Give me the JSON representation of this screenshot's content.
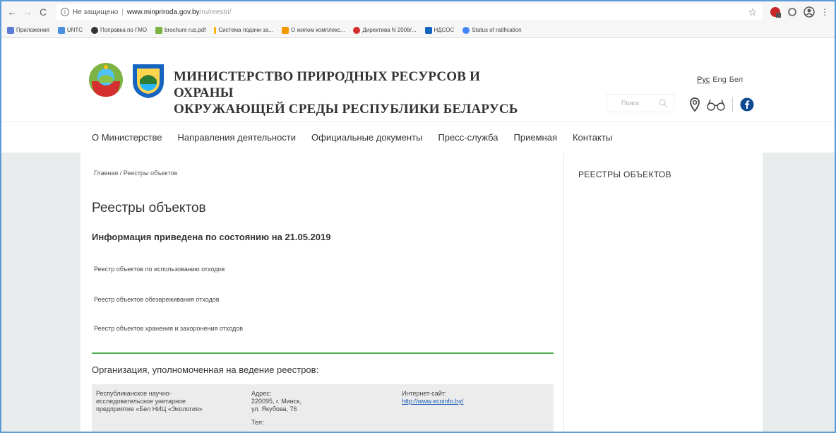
{
  "browser": {
    "security_label": "Не защищено",
    "url_host": "www.minpriroda.gov.by",
    "url_path": "/ru/reestri/"
  },
  "bookmarks": [
    {
      "label": "Приложения",
      "color": "#5b7dd8"
    },
    {
      "label": "UNTC",
      "color": "#4a90e2"
    },
    {
      "label": "Поправка по ГМО",
      "color": "#333333"
    },
    {
      "label": "brochure rus.pdf",
      "color": "#7cb342"
    },
    {
      "label": "Система подачи за...",
      "color": "#f4b400"
    },
    {
      "label": "О жилом комплекс...",
      "color": "#f29900"
    },
    {
      "label": "Директива N 2008/...",
      "color": "#d32f2f"
    },
    {
      "label": "НДСОС",
      "color": "#1565c0"
    },
    {
      "label": "Status of ratification",
      "color": "#4285f4"
    }
  ],
  "header": {
    "title_line1": "МИНИСТЕРСТВО ПРИРОДНЫХ РЕСУРСОВ И ОХРАНЫ",
    "title_line2": "ОКРУЖАЮЩЕЙ СРЕДЫ РЕСПУБЛИКИ БЕЛАРУСЬ",
    "lang_ru": "Рус",
    "lang_en": "Eng",
    "lang_be": "Бел",
    "search_placeholder": "Поиск"
  },
  "menu": [
    "О Министерстве",
    "Направления деятельности",
    "Официальные документы",
    "Пресс-служба",
    "Приемная",
    "Контакты"
  ],
  "main": {
    "breadcrumb": "Главная / Реестры объектов",
    "title": "Реестры объектов",
    "subtitle": "Информация приведена по состоянию на 21.05.2019",
    "links": [
      "Реестр объектов по использованию отходов",
      "Реестр объектов обезвреживания отходов",
      "Реестр объектов хранения и захоронения отходов"
    ],
    "org_title": "Организация, уполномоченная на ведение реестров:",
    "org": {
      "name_1": "Республиканское научно-",
      "name_2": "исследовательское унитарное",
      "name_3": "предприятие «Бел НИЦ «Экология»",
      "address_label": "Адрес:",
      "address_1": "220095, г. Минск,",
      "address_2": "ул. Якубова, 76",
      "phone_label": "Тел:",
      "site_label": "Интернет-сайт:",
      "site_url": "http://www.ecoinfo.by/"
    }
  },
  "sidebar": {
    "title": "РЕЕСТРЫ ОБЪЕКТОВ"
  }
}
